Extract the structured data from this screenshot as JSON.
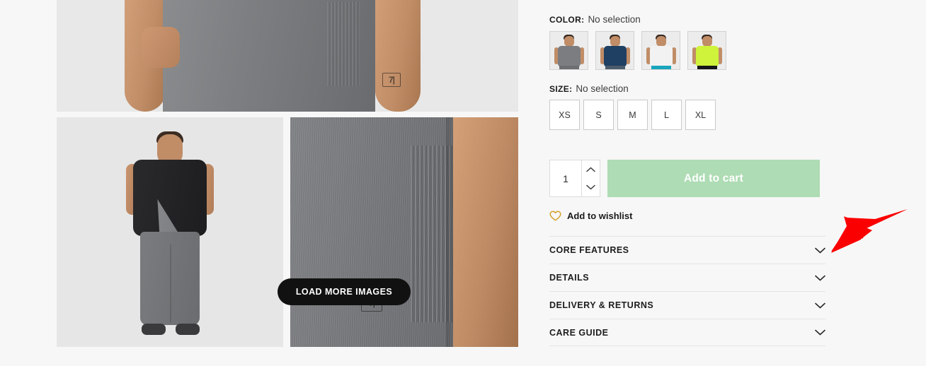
{
  "gallery": {
    "load_more_label": "LOAD MORE IMAGES",
    "images": [
      {
        "name": "hero-torso-shot",
        "alt": "Grey t-shirt torso close up"
      },
      {
        "name": "model-full-body-shot",
        "alt": "Model wearing grey tee, black vest and grey joggers"
      },
      {
        "name": "fabric-detail-shot",
        "alt": "Close up of grey textured fabric with logo patch"
      }
    ]
  },
  "options": {
    "color": {
      "label": "COLOR:",
      "value": "No selection",
      "swatches": [
        {
          "name": "grey",
          "shirt": "#7b7d80",
          "bottom": "#6c6e71"
        },
        {
          "name": "navy",
          "shirt": "#1f3f63",
          "bottom": "#4a5b6b"
        },
        {
          "name": "white",
          "shirt": "#f2f2f2",
          "bottom": "#18a5bd"
        },
        {
          "name": "lime",
          "shirt": "#cff23a",
          "bottom": "#16161a"
        }
      ]
    },
    "size": {
      "label": "SIZE:",
      "value": "No selection",
      "options": [
        "XS",
        "S",
        "M",
        "L",
        "XL"
      ]
    }
  },
  "purchase": {
    "quantity": "1",
    "quantity_increase": "increase-quantity",
    "quantity_decrease": "decrease-quantity",
    "add_to_cart_label": "Add to cart",
    "add_to_cart_color": "#aedcb4",
    "wishlist_label": "Add to wishlist",
    "wishlist_icon_color": "#d4a12a"
  },
  "accordion": {
    "sections": [
      {
        "title": "CORE FEATURES",
        "icon": "chevron-down-icon"
      },
      {
        "title": "DETAILS",
        "icon": "chevron-down-icon"
      },
      {
        "title": "DELIVERY & RETURNS",
        "icon": "chevron-down-icon"
      },
      {
        "title": "CARE GUIDE",
        "icon": "chevron-down-icon"
      }
    ]
  },
  "annotation": {
    "name": "red-pointer-arrow",
    "color": "#fa0000",
    "points_to": "CORE FEATURES"
  },
  "theme": {
    "page_background": "#f7f7f7"
  }
}
